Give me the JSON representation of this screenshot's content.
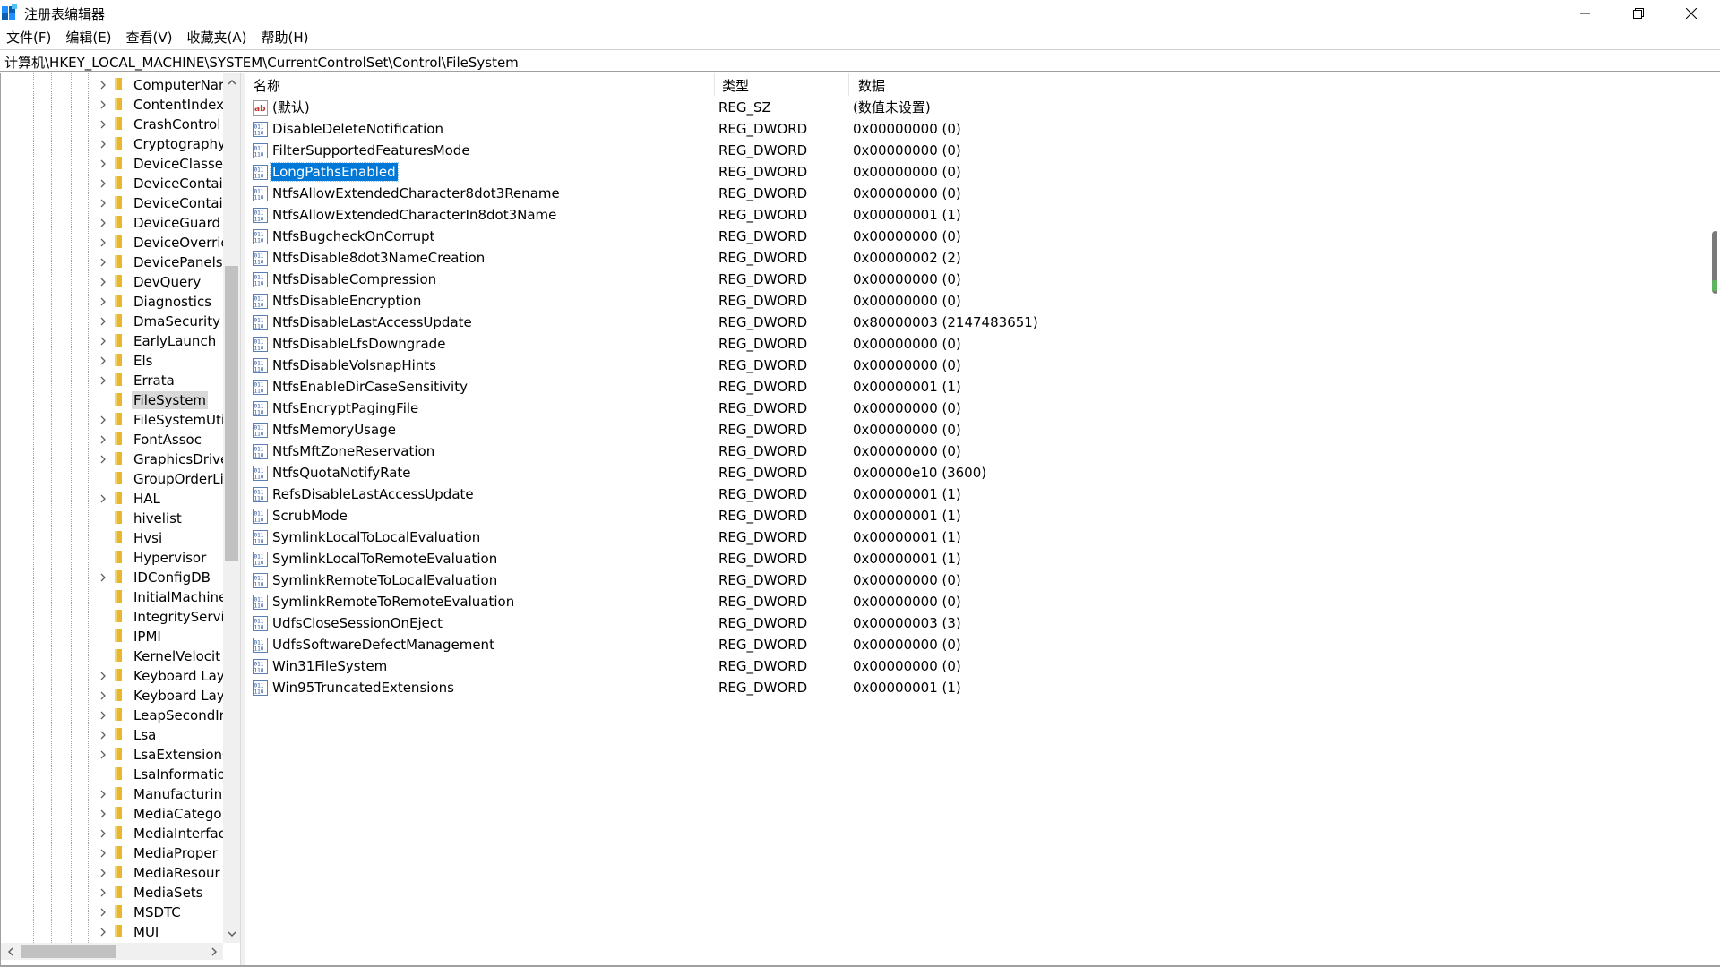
{
  "window": {
    "title": "注册表编辑器",
    "icon": "regedit-icon"
  },
  "menu": [
    "文件(F)",
    "编辑(E)",
    "查看(V)",
    "收藏夹(A)",
    "帮助(H)"
  ],
  "address": "计算机\\HKEY_LOCAL_MACHINE\\SYSTEM\\CurrentControlSet\\Control\\FileSystem",
  "tree": {
    "items": [
      {
        "label": "ComputerNar",
        "expandable": true
      },
      {
        "label": "ContentIndex",
        "expandable": true
      },
      {
        "label": "CrashControl",
        "expandable": true
      },
      {
        "label": "Cryptography",
        "expandable": true
      },
      {
        "label": "DeviceClasses",
        "expandable": true
      },
      {
        "label": "DeviceContai",
        "expandable": true
      },
      {
        "label": "DeviceContai",
        "expandable": true
      },
      {
        "label": "DeviceGuard",
        "expandable": true
      },
      {
        "label": "DeviceOverrid",
        "expandable": true
      },
      {
        "label": "DevicePanels",
        "expandable": true
      },
      {
        "label": "DevQuery",
        "expandable": true
      },
      {
        "label": "Diagnostics",
        "expandable": true
      },
      {
        "label": "DmaSecurity",
        "expandable": true
      },
      {
        "label": "EarlyLaunch",
        "expandable": true
      },
      {
        "label": "Els",
        "expandable": true
      },
      {
        "label": "Errata",
        "expandable": true
      },
      {
        "label": "FileSystem",
        "expandable": false,
        "selected": true
      },
      {
        "label": "FileSystemUti",
        "expandable": true
      },
      {
        "label": "FontAssoc",
        "expandable": true
      },
      {
        "label": "GraphicsDrive",
        "expandable": true
      },
      {
        "label": "GroupOrderLi",
        "expandable": false
      },
      {
        "label": "HAL",
        "expandable": true
      },
      {
        "label": "hivelist",
        "expandable": false
      },
      {
        "label": "Hvsi",
        "expandable": false
      },
      {
        "label": "Hypervisor",
        "expandable": false
      },
      {
        "label": "IDConfigDB",
        "expandable": true
      },
      {
        "label": "InitialMachine",
        "expandable": false
      },
      {
        "label": "IntegrityServi",
        "expandable": false
      },
      {
        "label": "IPMI",
        "expandable": false
      },
      {
        "label": "KernelVelocit",
        "expandable": false
      },
      {
        "label": "Keyboard Lay",
        "expandable": true
      },
      {
        "label": "Keyboard Lay",
        "expandable": true
      },
      {
        "label": "LeapSecondIn",
        "expandable": true
      },
      {
        "label": "Lsa",
        "expandable": true
      },
      {
        "label": "LsaExtensionC",
        "expandable": true
      },
      {
        "label": "LsaInformatio",
        "expandable": false
      },
      {
        "label": "Manufacturin",
        "expandable": true
      },
      {
        "label": "MediaCatego",
        "expandable": true
      },
      {
        "label": "MediaInterfac",
        "expandable": true
      },
      {
        "label": "MediaProper",
        "expandable": true
      },
      {
        "label": "MediaResour",
        "expandable": true
      },
      {
        "label": "MediaSets",
        "expandable": true
      },
      {
        "label": "MSDTC",
        "expandable": true
      },
      {
        "label": "MUI",
        "expandable": true
      }
    ]
  },
  "columns": {
    "name": "名称",
    "type": "类型",
    "data": "数据"
  },
  "values": [
    {
      "name": "(默认)",
      "type": "REG_SZ",
      "data": "(数值未设置)",
      "icon": "string-value-icon"
    },
    {
      "name": "DisableDeleteNotification",
      "type": "REG_DWORD",
      "data": "0x00000000 (0)",
      "icon": "binary-value-icon"
    },
    {
      "name": "FilterSupportedFeaturesMode",
      "type": "REG_DWORD",
      "data": "0x00000000 (0)",
      "icon": "binary-value-icon"
    },
    {
      "name": "LongPathsEnabled",
      "type": "REG_DWORD",
      "data": "0x00000000 (0)",
      "icon": "binary-value-icon",
      "selected": true
    },
    {
      "name": "NtfsAllowExtendedCharacter8dot3Rename",
      "type": "REG_DWORD",
      "data": "0x00000000 (0)",
      "icon": "binary-value-icon"
    },
    {
      "name": "NtfsAllowExtendedCharacterIn8dot3Name",
      "type": "REG_DWORD",
      "data": "0x00000001 (1)",
      "icon": "binary-value-icon"
    },
    {
      "name": "NtfsBugcheckOnCorrupt",
      "type": "REG_DWORD",
      "data": "0x00000000 (0)",
      "icon": "binary-value-icon"
    },
    {
      "name": "NtfsDisable8dot3NameCreation",
      "type": "REG_DWORD",
      "data": "0x00000002 (2)",
      "icon": "binary-value-icon"
    },
    {
      "name": "NtfsDisableCompression",
      "type": "REG_DWORD",
      "data": "0x00000000 (0)",
      "icon": "binary-value-icon"
    },
    {
      "name": "NtfsDisableEncryption",
      "type": "REG_DWORD",
      "data": "0x00000000 (0)",
      "icon": "binary-value-icon"
    },
    {
      "name": "NtfsDisableLastAccessUpdate",
      "type": "REG_DWORD",
      "data": "0x80000003 (2147483651)",
      "icon": "binary-value-icon"
    },
    {
      "name": "NtfsDisableLfsDowngrade",
      "type": "REG_DWORD",
      "data": "0x00000000 (0)",
      "icon": "binary-value-icon"
    },
    {
      "name": "NtfsDisableVolsnapHints",
      "type": "REG_DWORD",
      "data": "0x00000000 (0)",
      "icon": "binary-value-icon"
    },
    {
      "name": "NtfsEnableDirCaseSensitivity",
      "type": "REG_DWORD",
      "data": "0x00000001 (1)",
      "icon": "binary-value-icon"
    },
    {
      "name": "NtfsEncryptPagingFile",
      "type": "REG_DWORD",
      "data": "0x00000000 (0)",
      "icon": "binary-value-icon"
    },
    {
      "name": "NtfsMemoryUsage",
      "type": "REG_DWORD",
      "data": "0x00000000 (0)",
      "icon": "binary-value-icon"
    },
    {
      "name": "NtfsMftZoneReservation",
      "type": "REG_DWORD",
      "data": "0x00000000 (0)",
      "icon": "binary-value-icon"
    },
    {
      "name": "NtfsQuotaNotifyRate",
      "type": "REG_DWORD",
      "data": "0x00000e10 (3600)",
      "icon": "binary-value-icon"
    },
    {
      "name": "RefsDisableLastAccessUpdate",
      "type": "REG_DWORD",
      "data": "0x00000001 (1)",
      "icon": "binary-value-icon"
    },
    {
      "name": "ScrubMode",
      "type": "REG_DWORD",
      "data": "0x00000001 (1)",
      "icon": "binary-value-icon"
    },
    {
      "name": "SymlinkLocalToLocalEvaluation",
      "type": "REG_DWORD",
      "data": "0x00000001 (1)",
      "icon": "binary-value-icon"
    },
    {
      "name": "SymlinkLocalToRemoteEvaluation",
      "type": "REG_DWORD",
      "data": "0x00000001 (1)",
      "icon": "binary-value-icon"
    },
    {
      "name": "SymlinkRemoteToLocalEvaluation",
      "type": "REG_DWORD",
      "data": "0x00000000 (0)",
      "icon": "binary-value-icon"
    },
    {
      "name": "SymlinkRemoteToRemoteEvaluation",
      "type": "REG_DWORD",
      "data": "0x00000000 (0)",
      "icon": "binary-value-icon"
    },
    {
      "name": "UdfsCloseSessionOnEject",
      "type": "REG_DWORD",
      "data": "0x00000003 (3)",
      "icon": "binary-value-icon"
    },
    {
      "name": "UdfsSoftwareDefectManagement",
      "type": "REG_DWORD",
      "data": "0x00000000 (0)",
      "icon": "binary-value-icon"
    },
    {
      "name": "Win31FileSystem",
      "type": "REG_DWORD",
      "data": "0x00000000 (0)",
      "icon": "binary-value-icon"
    },
    {
      "name": "Win95TruncatedExtensions",
      "type": "REG_DWORD",
      "data": "0x00000001 (1)",
      "icon": "binary-value-icon"
    }
  ],
  "colors": {
    "selection": "#0078d7",
    "tree_selection": "#d9d9d9",
    "folder": "#e8b730"
  }
}
